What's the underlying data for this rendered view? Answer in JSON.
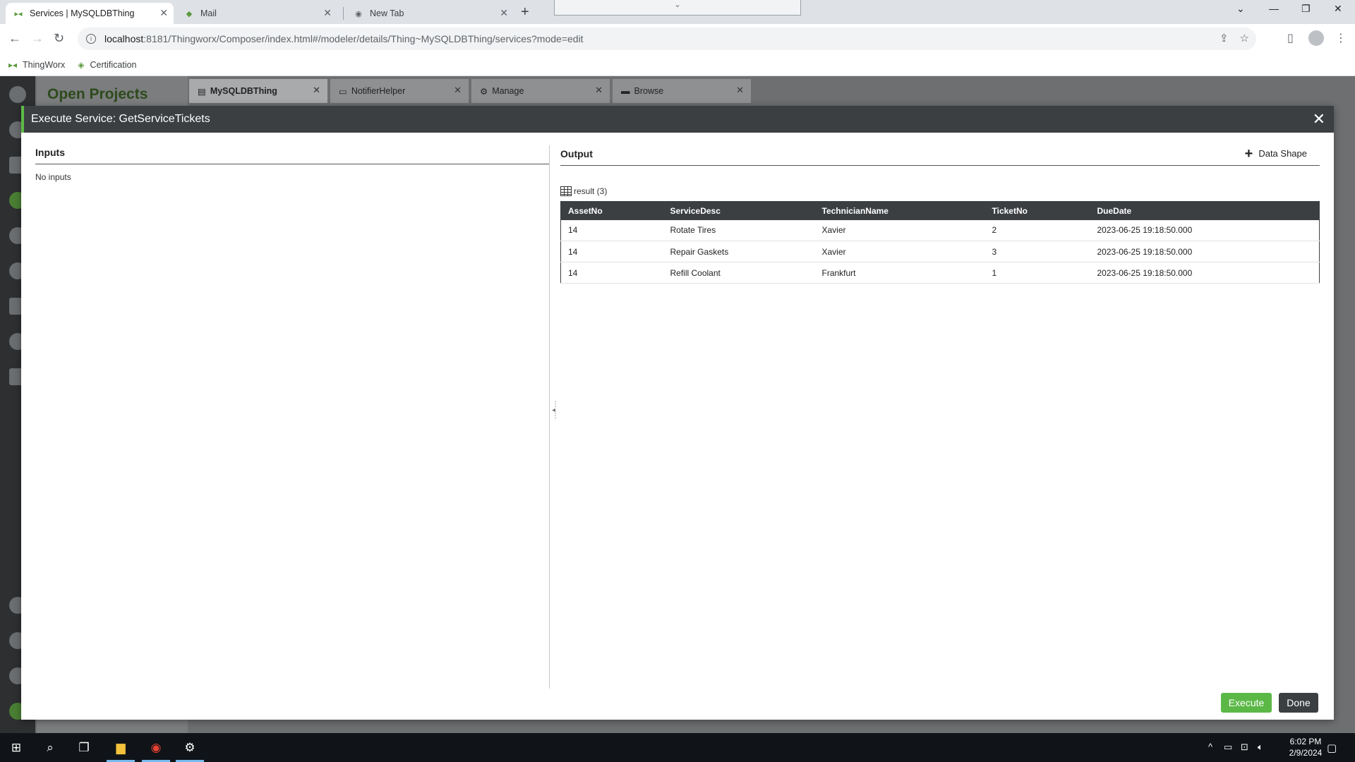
{
  "browser": {
    "tabs": [
      {
        "title": "Services | MySQLDBThing",
        "active": true
      },
      {
        "title": "Mail",
        "active": false
      },
      {
        "title": "New Tab",
        "active": false
      }
    ],
    "url_host": "localhost",
    "url_rest": ":8181/Thingworx/Composer/index.html#/modeler/details/Thing~MySQLDBThing/services?mode=edit",
    "bookmarks": [
      "ThingWorx",
      "Certification"
    ]
  },
  "background_app": {
    "projects_title": "Open Projects",
    "tabs": [
      "MySQLDBThing",
      "NotifierHelper",
      "Manage",
      "Browse"
    ]
  },
  "modal": {
    "title": "Execute Service: GetServiceTickets",
    "inputs": {
      "heading": "Inputs",
      "empty_text": "No inputs"
    },
    "output": {
      "heading": "Output",
      "data_shape_label": "Data Shape",
      "result_label": "result (3)",
      "columns": [
        "AssetNo",
        "ServiceDesc",
        "TechnicianName",
        "TicketNo",
        "DueDate"
      ],
      "rows": [
        [
          "14",
          "Rotate Tires",
          "Xavier",
          "2",
          "2023-06-25 19:18:50.000"
        ],
        [
          "14",
          "Repair Gaskets",
          "Xavier",
          "3",
          "2023-06-25 19:18:50.000"
        ],
        [
          "14",
          "Refill Coolant",
          "Frankfurt",
          "1",
          "2023-06-25 19:18:50.000"
        ]
      ]
    },
    "buttons": {
      "execute": "Execute",
      "done": "Done"
    }
  },
  "taskbar": {
    "time": "6:02 PM",
    "date": "2/9/2024"
  },
  "colors": {
    "accent_green": "#5bb846",
    "header_dark": "#3c3f42"
  }
}
